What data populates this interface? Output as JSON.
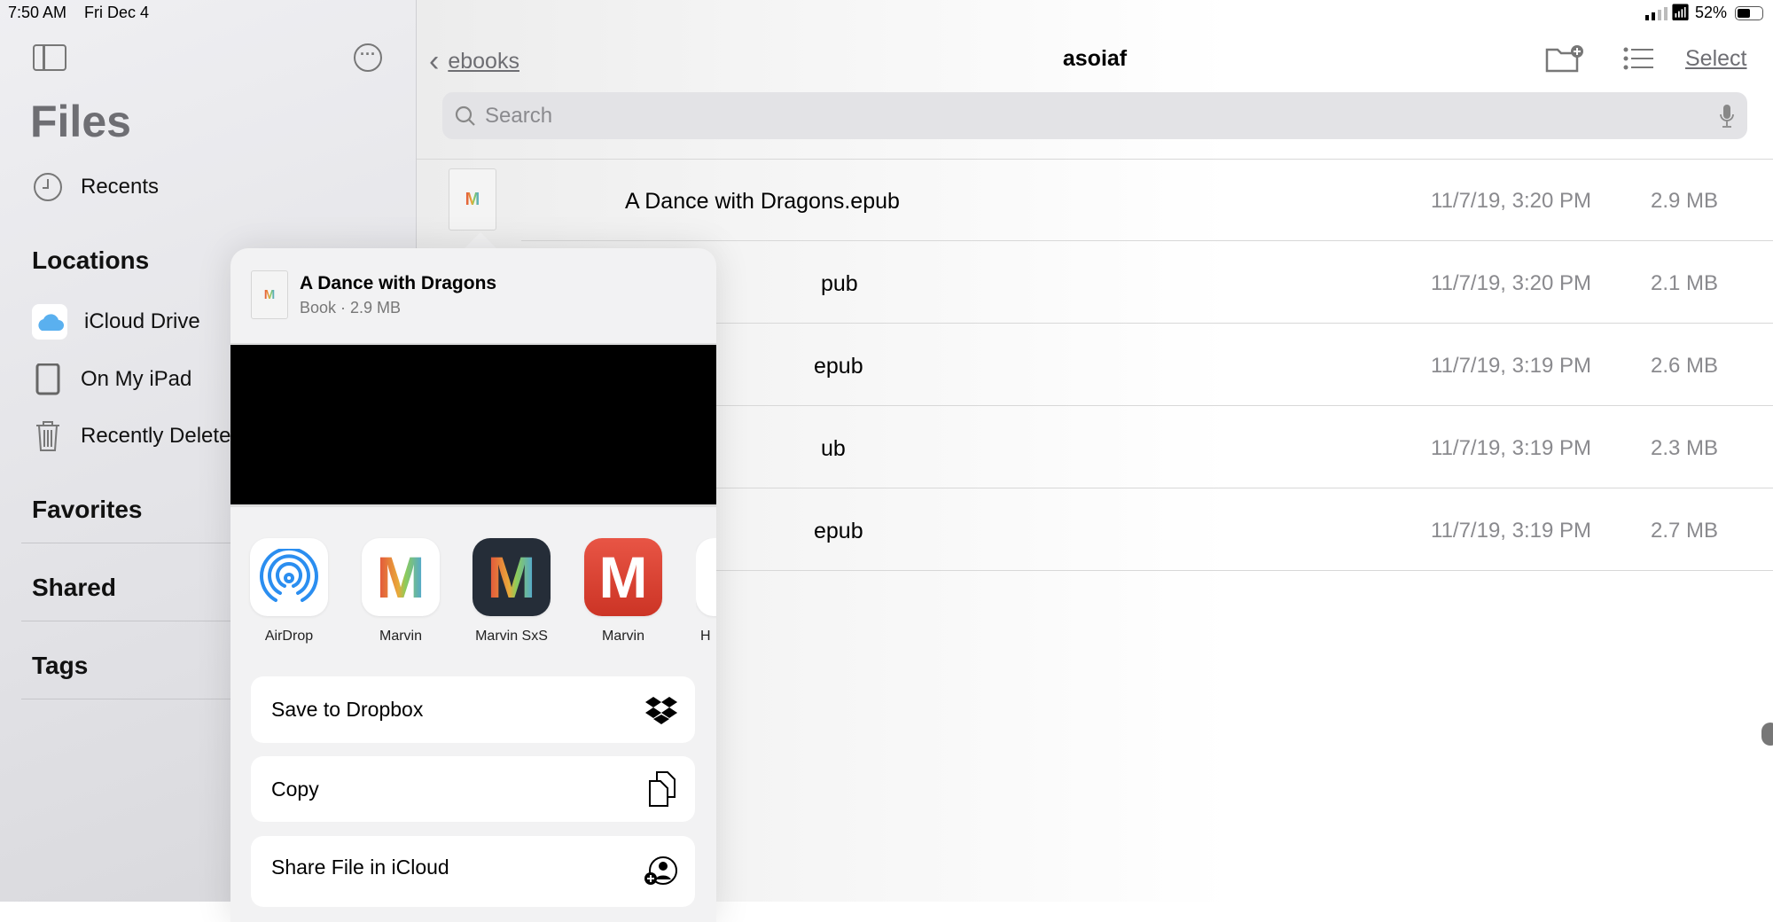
{
  "status_bar": {
    "time": "7:50 AM",
    "date": "Fri Dec 4",
    "battery": "52%",
    "battery_level": 0.52
  },
  "sidebar": {
    "title": "Files",
    "recents": "Recents",
    "locations_heading": "Locations",
    "locations": [
      {
        "label": "iCloud Drive",
        "icon": "icloud-icon"
      },
      {
        "label": "On My iPad",
        "icon": "ipad-icon"
      },
      {
        "label": "Recently Deleted",
        "icon": "trash-icon"
      }
    ],
    "favorites": "Favorites",
    "shared": "Shared",
    "tags": "Tags"
  },
  "header": {
    "back_label": "ebooks",
    "title": "asoiaf",
    "select_label": "Select",
    "search_placeholder": "Search"
  },
  "files": [
    {
      "name": "A Dance with Dragons.epub",
      "date": "11/7/19, 3:20 PM",
      "size": "2.9 MB"
    },
    {
      "name": "pub",
      "date": "11/7/19, 3:20 PM",
      "size": "2.1 MB"
    },
    {
      "name": "epub",
      "date": "11/7/19, 3:19 PM",
      "size": "2.6 MB"
    },
    {
      "name": "ub",
      "date": "11/7/19, 3:19 PM",
      "size": "2.3 MB"
    },
    {
      "name": "epub",
      "date": "11/7/19, 3:19 PM",
      "size": "2.7 MB"
    }
  ],
  "share_sheet": {
    "title": "A Dance with Dragons",
    "subtitle": "Book · 2.9 MB",
    "apps": [
      {
        "label": "AirDrop"
      },
      {
        "label": "Marvin"
      },
      {
        "label": "Marvin SxS"
      },
      {
        "label": "Marvin"
      },
      {
        "label": "H"
      }
    ],
    "actions": [
      {
        "label": "Save to Dropbox",
        "icon": "dropbox-icon"
      },
      {
        "label": "Copy",
        "icon": "copy-icon"
      },
      {
        "label": "Share File in iCloud",
        "icon": "share-person-icon"
      }
    ]
  },
  "colors": {
    "accent": "#6e6e73",
    "airdrop": "#2b8ef0",
    "marvin_red": "#e0473a",
    "marvin_dark": "#252d38"
  }
}
